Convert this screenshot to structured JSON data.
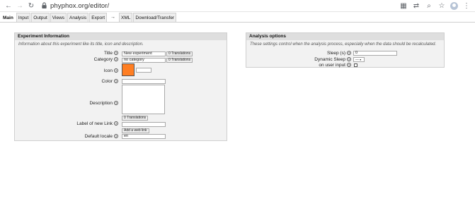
{
  "browser": {
    "url": "phyphox.org/editor/"
  },
  "tabs": [
    {
      "label": "Main"
    },
    {
      "label": "Input"
    },
    {
      "label": "Output"
    },
    {
      "label": "Views"
    },
    {
      "label": "Analysis"
    },
    {
      "label": "Export"
    },
    {
      "label": "→"
    },
    {
      "label": "XML"
    },
    {
      "label": "Download/Transfer"
    }
  ],
  "experiment": {
    "title": "Experiment Information",
    "description": "Information about this experiment like its title, icon and description.",
    "fields": {
      "title_label": "Title",
      "title_value": "New experiment",
      "category_label": "Category",
      "category_value": "no category",
      "icon_label": "Icon",
      "color_label": "Color",
      "description_label": "Description",
      "link_label": "Label of new Link",
      "add_link": "Add a web link",
      "locale_label": "Default locale",
      "locale_value": "en",
      "translations": "0 Translations"
    },
    "icon_color": "#ff7e22"
  },
  "analysis": {
    "title": "Analysis options",
    "description": "These settings control when the analysis process, especially when the data should be recalculated.",
    "sleep_label": "Sleep (s)",
    "sleep_value": "0",
    "dynamic_sleep_label": "Dynamic Sleep",
    "dynamic_sleep_value": "---",
    "on_user_input_label": "on user input"
  }
}
